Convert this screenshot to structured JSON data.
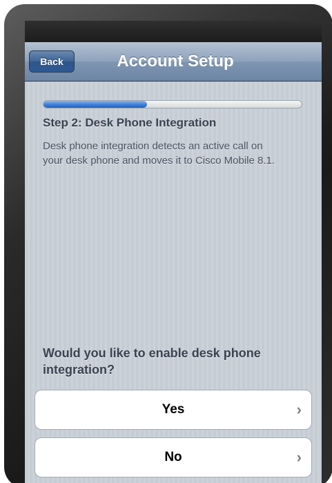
{
  "nav": {
    "back_label": "Back",
    "title": "Account Setup"
  },
  "progress": {
    "fraction": 0.4
  },
  "step": {
    "title": "Step 2: Desk Phone Integration",
    "description": "Desk phone integration detects an active call on your desk phone and moves it to Cisco Mobile 8.1."
  },
  "question": "Would you like to enable desk phone integration?",
  "options": [
    {
      "label": "Yes",
      "icon": "chevron-right-icon"
    },
    {
      "label": "No",
      "icon": "chevron-right-icon"
    }
  ],
  "colors": {
    "accent": "#3b7dd8",
    "nav_bar": "#8da2bc",
    "background": "#c5ccd4"
  }
}
